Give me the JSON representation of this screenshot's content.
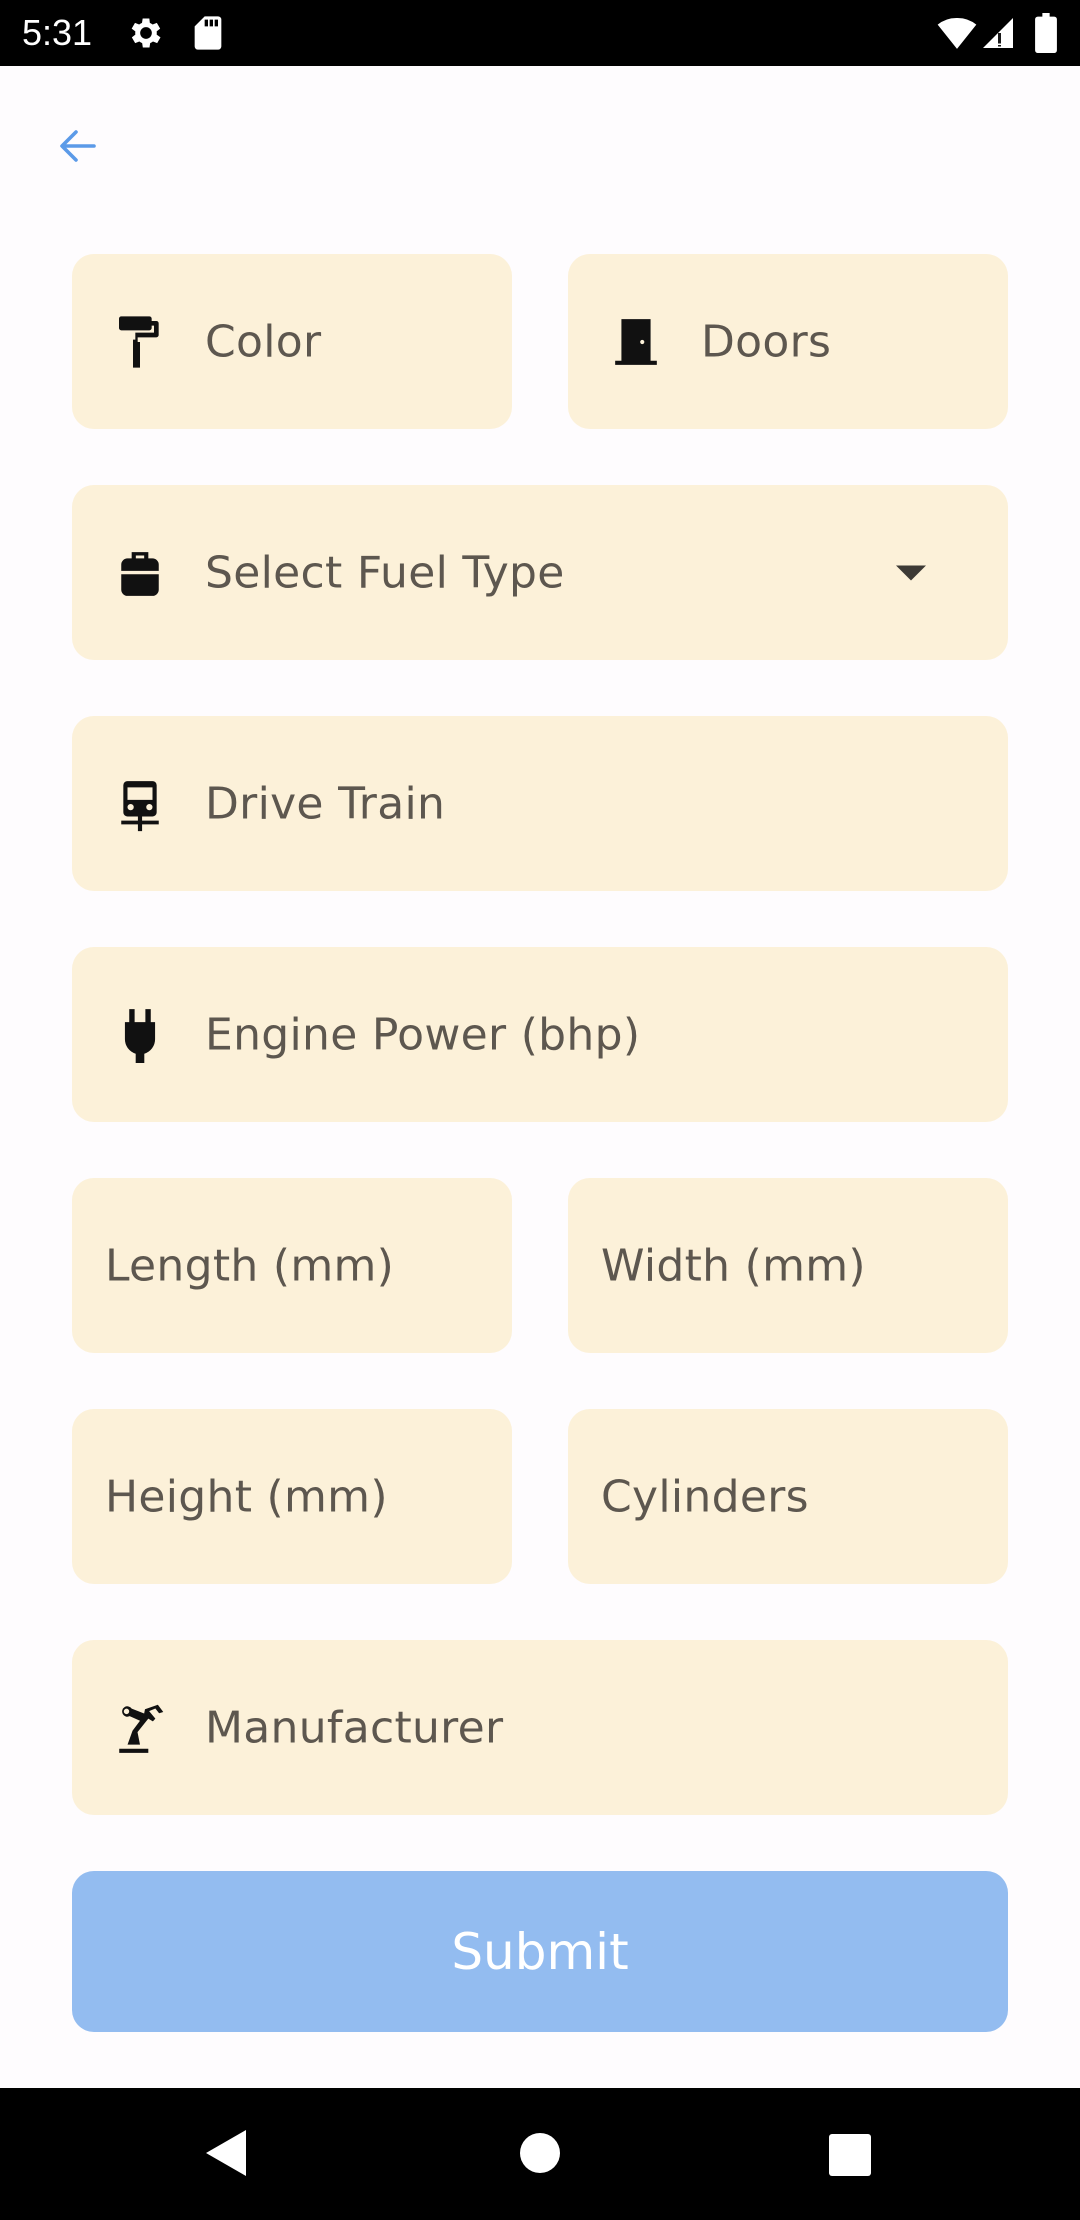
{
  "status_bar": {
    "time": "5:31",
    "icons": [
      "settings-icon",
      "sd-card-icon",
      "wifi-icon",
      "signal-icon",
      "battery-icon"
    ]
  },
  "toolbar": {
    "back_icon": "arrow-left-icon",
    "accent_color": "#5b9ae8"
  },
  "form": {
    "color_field": {
      "placeholder": "Color",
      "icon": "paint-roller-icon"
    },
    "doors_field": {
      "placeholder": "Doors",
      "icon": "door-icon"
    },
    "fuel_type_select": {
      "placeholder": "Select Fuel Type",
      "icon": "gas-can-icon"
    },
    "drive_train_field": {
      "placeholder": "Drive Train",
      "icon": "car-icon"
    },
    "engine_power_field": {
      "placeholder": "Engine Power (bhp)",
      "icon": "plug-icon"
    },
    "length_field": {
      "placeholder": "Length (mm)"
    },
    "width_field": {
      "placeholder": "Width (mm)"
    },
    "height_field": {
      "placeholder": "Height (mm)"
    },
    "cylinders_field": {
      "placeholder": "Cylinders"
    },
    "manufacturer_field": {
      "placeholder": "Manufacturer",
      "icon": "robot-arm-icon"
    },
    "field_background": "#fcf1d9",
    "submit_label": "Submit",
    "submit_color": "#93bcf0"
  },
  "nav_bar": {
    "items": [
      "back-triangle-icon",
      "home-circle-icon",
      "recents-square-icon"
    ]
  }
}
